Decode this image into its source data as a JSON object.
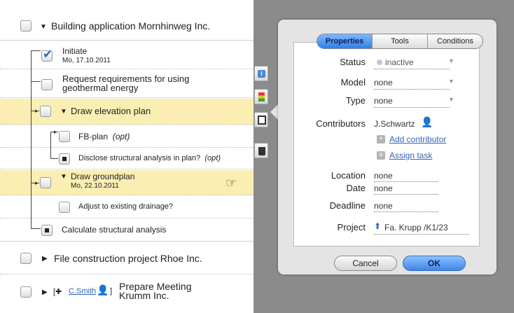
{
  "tree": {
    "groups": [
      {
        "label": "Building application Mornhinweg Inc."
      },
      {
        "label": "File construction project Rhoe Inc."
      },
      {
        "label": "Prepare Meeting Krumm Inc.",
        "line1": "Prepare Meeting",
        "line2": "Krumm Inc.",
        "assignee_prefix": "[✚",
        "assignee": "C.Smith",
        "assignee_suffix": "]"
      }
    ],
    "tasks": {
      "initiate": {
        "label": "Initiate",
        "date": "Mo, 17.10.2011"
      },
      "request": {
        "label": "Request requirements for using geothermal energy",
        "line1": "Request requirements for using",
        "line2": "geothermal energy"
      },
      "elevation": {
        "label": "Draw elevation plan"
      },
      "fbplan": {
        "label": "FB-plan",
        "opt": "(opt)"
      },
      "disclose": {
        "label": "Disclose structural analysis in plan?",
        "opt": "(opt)"
      },
      "groundplan": {
        "label": "Draw groundplan",
        "date": "Mo, 22.10.2011"
      },
      "drainage": {
        "label": "Adjust to existing drainage?"
      },
      "calculate": {
        "label": "Calculate structural analysis"
      }
    }
  },
  "toolbar": {
    "icons": [
      "info-icon",
      "color-icon",
      "save-icon",
      "trash-icon"
    ]
  },
  "dialog": {
    "tabs": [
      "Properties",
      "Tools",
      "Conditions"
    ],
    "active_tab": "Properties",
    "fields": {
      "status": {
        "label": "Status",
        "value": "inactive"
      },
      "model": {
        "label": "Model",
        "value": "none"
      },
      "type": {
        "label": "Type",
        "value": "none"
      },
      "contributors": {
        "label": "Contributors",
        "value": "J.Schwartz"
      },
      "add_contributor": "Add contributor",
      "assign_task": "Assign task",
      "location": {
        "label": "Location",
        "value": "none"
      },
      "date": {
        "label": "Date",
        "value": "none"
      },
      "deadline": {
        "label": "Deadline",
        "value": "none"
      },
      "project": {
        "label": "Project",
        "value": "Fa. Krupp /K1/23"
      }
    },
    "buttons": {
      "cancel": "Cancel",
      "ok": "OK"
    }
  },
  "colors": {
    "highlight": "#fbeeb3",
    "accent": "#2f7fe6",
    "link": "#3466b7"
  }
}
